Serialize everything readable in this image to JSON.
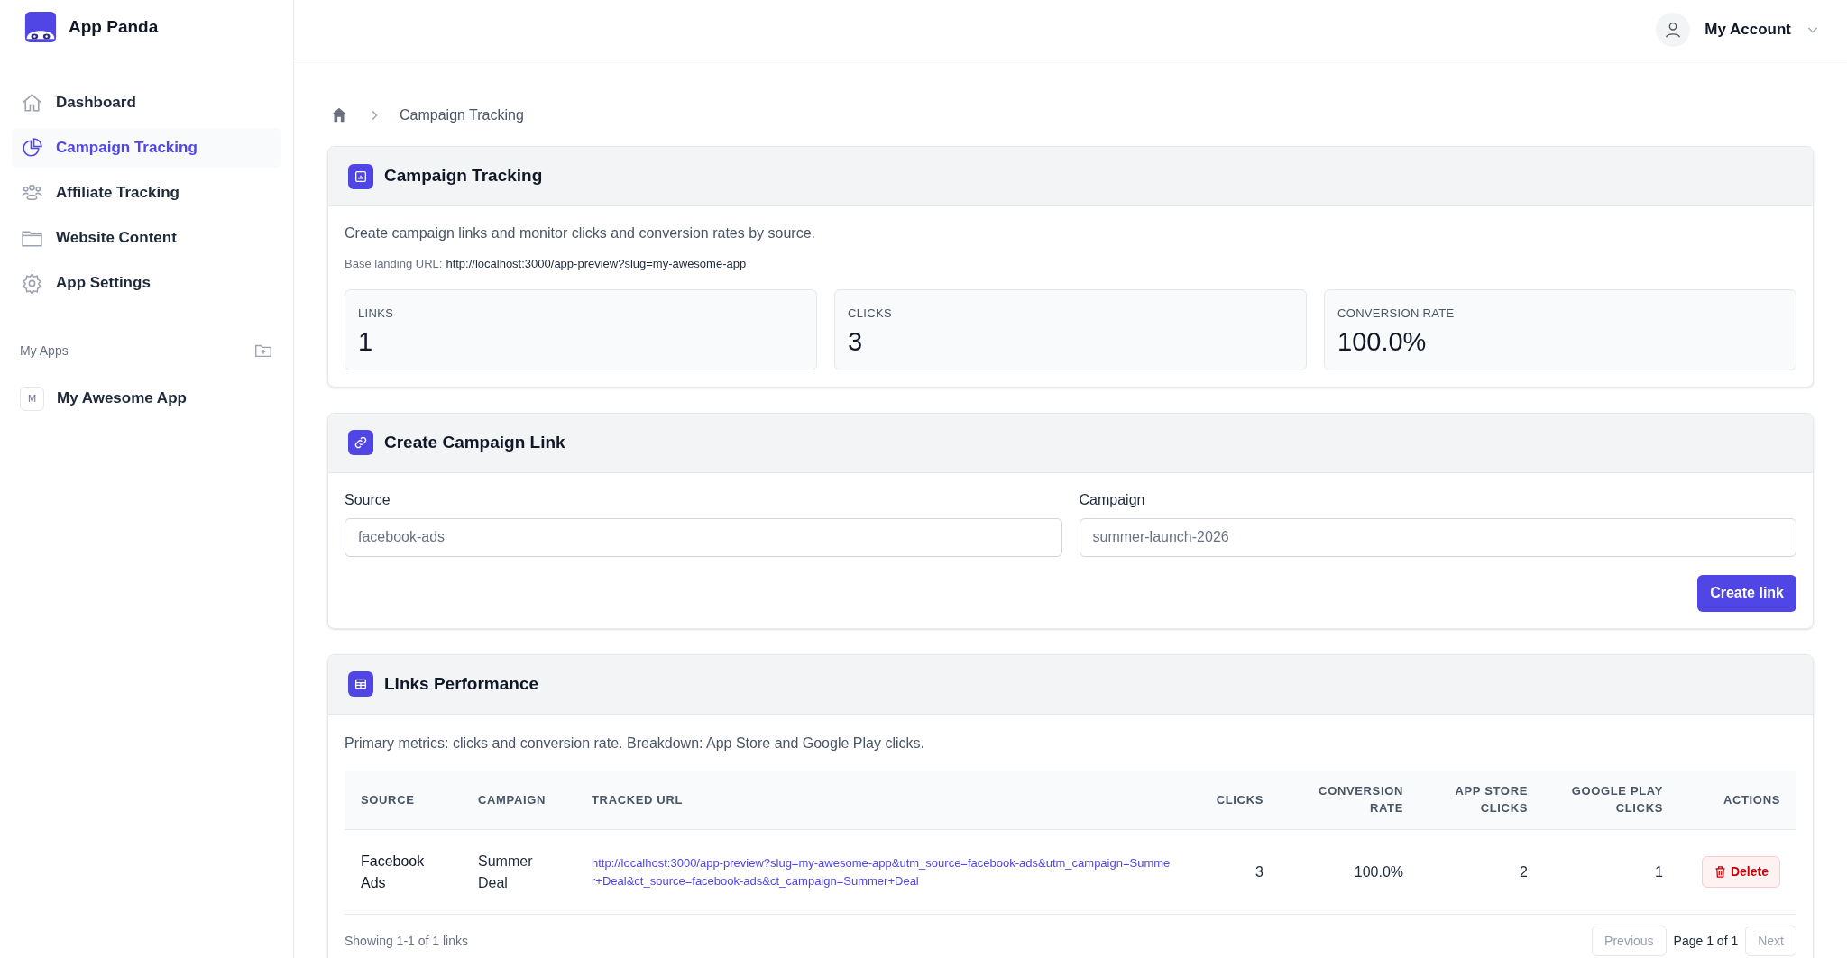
{
  "brand": {
    "name": "App Panda"
  },
  "nav": [
    {
      "label": "Dashboard",
      "selected": false
    },
    {
      "label": "Campaign Tracking",
      "selected": true
    },
    {
      "label": "Affiliate Tracking",
      "selected": false
    },
    {
      "label": "Website Content",
      "selected": false
    },
    {
      "label": "App Settings",
      "selected": false
    }
  ],
  "apps_section": {
    "title": "My Apps",
    "apps": [
      {
        "initial": "M",
        "name": "My Awesome App"
      }
    ]
  },
  "account": {
    "label": "My Account"
  },
  "breadcrumb": [
    "Campaign Tracking"
  ],
  "overview": {
    "title": "Campaign Tracking",
    "description": "Create campaign links and monitor clicks and conversion rates by source.",
    "base_url_label": "Base landing URL:",
    "base_url": "http://localhost:3000/app-preview?slug=my-awesome-app",
    "stats": [
      {
        "label": "LINKS",
        "value": "1"
      },
      {
        "label": "CLICKS",
        "value": "3"
      },
      {
        "label": "CONVERSION RATE",
        "value": "100.0%"
      }
    ]
  },
  "create": {
    "title": "Create Campaign Link",
    "fields": [
      {
        "label": "Source",
        "placeholder": "facebook-ads"
      },
      {
        "label": "Campaign",
        "placeholder": "summer-launch-2026"
      }
    ],
    "button": "Create link"
  },
  "performance": {
    "title": "Links Performance",
    "description": "Primary metrics: clicks and conversion rate. Breakdown: App Store and Google Play clicks.",
    "columns": [
      "SOURCE",
      "CAMPAIGN",
      "TRACKED URL",
      "CLICKS",
      "CONVERSION RATE",
      "APP STORE CLICKS",
      "GOOGLE PLAY CLICKS",
      "ACTIONS"
    ],
    "rows": [
      {
        "source": "Facebook Ads",
        "campaign": "Summer Deal",
        "url": "http://localhost:3000/app-preview?slug=my-awesome-app&utm_source=facebook-ads&utm_campaign=Summer+Deal&ct_source=facebook-ads&ct_campaign=Summer+Deal",
        "clicks": "3",
        "conversion": "100.0%",
        "app_store": "2",
        "google_play": "1",
        "action": "Delete"
      }
    ],
    "summary": "Showing 1-1 of 1 links",
    "pagination": {
      "previous": {
        "label": "Previous",
        "disabled": true
      },
      "page": "Page 1 of 1",
      "next": {
        "label": "Next",
        "disabled": true
      }
    }
  }
}
